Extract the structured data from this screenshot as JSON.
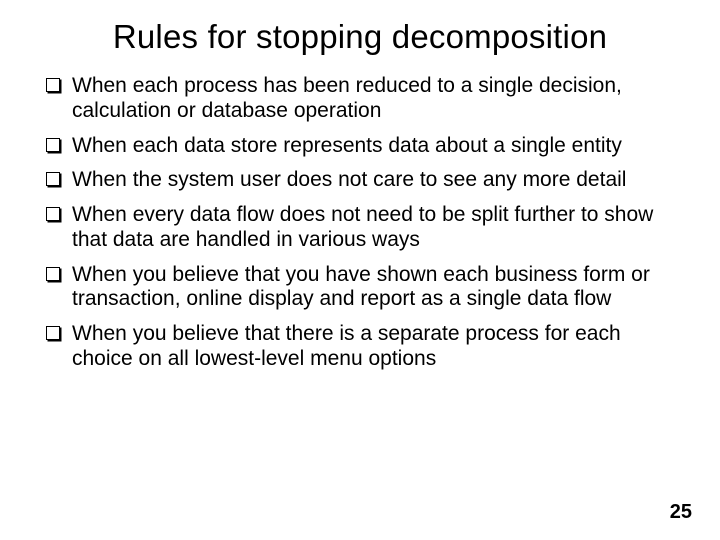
{
  "slide": {
    "title": "Rules for stopping decomposition",
    "bullets": [
      "When each process has been reduced to a single decision, calculation or database operation",
      "When each data store represents data about a single entity",
      "When the system user does not care to see any more detail",
      "When every data flow does not need to be split further to show that data are handled in various ways",
      "When you believe that you have shown each business form or transaction, online display and report as a single data flow",
      "When you believe that there is a separate process for each choice on all lowest-level menu options"
    ],
    "page_number": "25"
  }
}
